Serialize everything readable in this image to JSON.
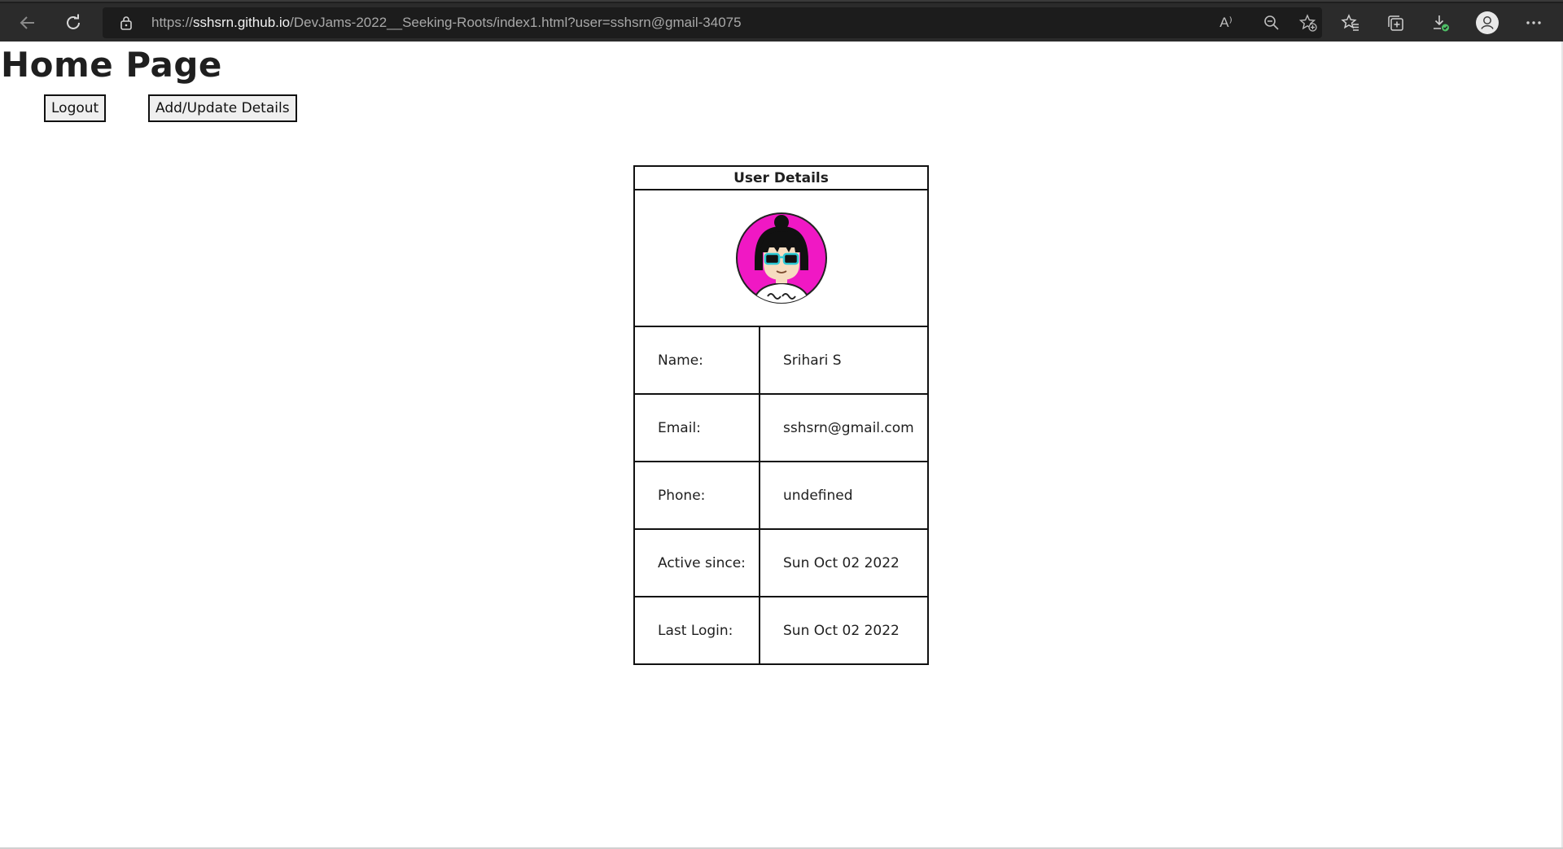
{
  "browser": {
    "url_prefix": "https://",
    "url_host": "sshsrn.github.io",
    "url_path": "/DevJams-2022__Seeking-Roots/index1.html?user=sshsrn@gmail-34075",
    "read_aloud_label": "A⁾"
  },
  "page": {
    "title": "Home Page",
    "logout_label": "Logout",
    "add_update_label": "Add/Update Details"
  },
  "user_table": {
    "header": "User Details",
    "rows": [
      {
        "label": "Name:",
        "value": "Srihari S"
      },
      {
        "label": "Email:",
        "value": "sshsrn@gmail.com"
      },
      {
        "label": "Phone:",
        "value": "undefined"
      },
      {
        "label": "Active since:",
        "value": "Sun Oct 02 2022"
      },
      {
        "label": "Last Login:",
        "value": "Sun Oct 02 2022"
      }
    ]
  },
  "colors": {
    "avatar_background": "#f018c4",
    "chrome_background": "#2b2b2b",
    "address_background": "#1c1c1c"
  },
  "icons": [
    "back-icon",
    "refresh-icon",
    "lock-icon",
    "read-aloud-icon",
    "zoom-out-icon",
    "add-favorite-icon",
    "favorites-icon",
    "collections-icon",
    "downloads-icon",
    "profile-icon",
    "more-icon"
  ]
}
